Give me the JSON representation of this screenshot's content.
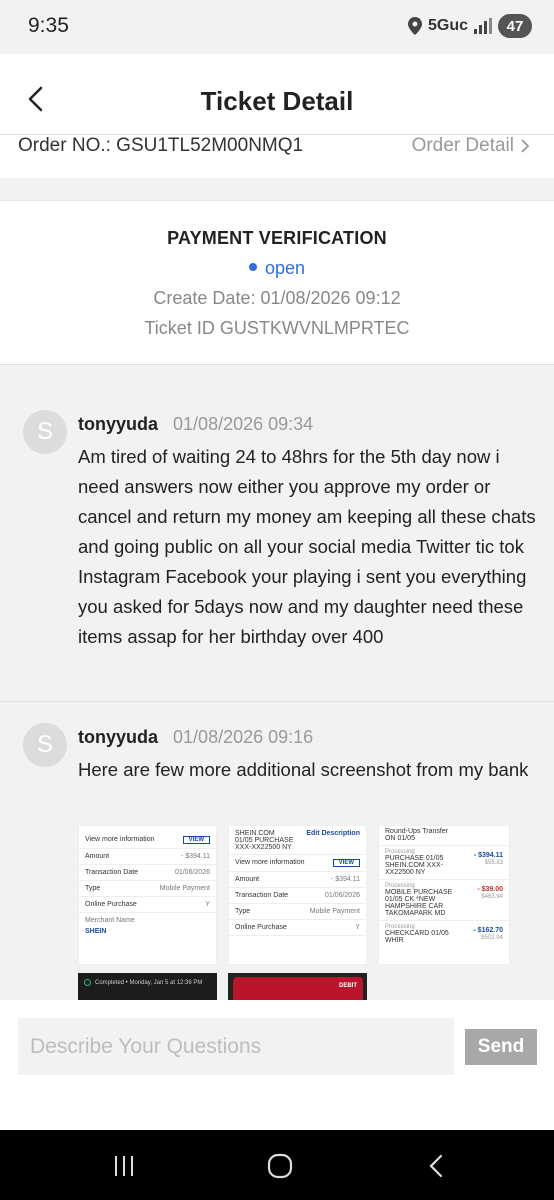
{
  "status_bar": {
    "time": "9:35",
    "network": "5Guc",
    "battery": "47"
  },
  "header": {
    "title": "Ticket Detail"
  },
  "order": {
    "order_no": "Order NO.: GSU1TL52M00NMQ1",
    "detail_link": "Order Detail"
  },
  "ticket": {
    "type": "PAYMENT VERIFICATION",
    "status": "open",
    "create_date": "Create Date: 01/08/2026 09:12",
    "ticket_id": "Ticket ID GUSTKWVNLMPRTEC"
  },
  "messages": [
    {
      "avatar": "S",
      "user": "tonyyuda",
      "time": "01/08/2026 09:34",
      "text": "Am tired of waiting 24 to 48hrs for the 5th day now i need answers now either you approve my order or cancel and return my money am keeping all these chats and going public on all your social media Twitter tic tok Instagram Facebook your playing i sent you everything you asked for 5days now and my daughter need these items assap for her birthday over 400"
    },
    {
      "avatar": "S",
      "user": "tonyyuda",
      "time": "01/08/2026 09:16",
      "text": "Here are few more additional screenshot from my bank"
    }
  ],
  "attachments": {
    "a1": {
      "view_more": "View more information",
      "view": "VIEW",
      "amount_label": "Amount",
      "amount": "- $394.11",
      "date_label": "Transaction Date",
      "date": "01/06/2026",
      "type_label": "Type",
      "type": "Mobile Payment",
      "online": "Online Purchase",
      "online_val": "Y",
      "merchant": "Merchant Name",
      "shein": "SHEIN"
    },
    "a2": {
      "line1": "SHEIN.COM",
      "line2": "01/05 PURCHASE",
      "line3": "XXX-XX22500 NY",
      "edit": "Edit Description",
      "view_more": "View more information",
      "view": "VIEW",
      "amount_label": "Amount",
      "amount": "- $394.11",
      "date_label": "Transaction Date",
      "date": "01/06/2026",
      "type_label": "Type",
      "type": "Mobile Payment",
      "online": "Online Purchase",
      "online_val": "Y"
    },
    "a3": {
      "top": "Round-Ups Transfer",
      "top2": "ON 01/05",
      "p1_label": "Processing",
      "p1_desc": "PURCHASE 01/05 SHEIN.COM XXX-XX22500 NY",
      "p1_amt": "- $394.11",
      "p1_bal": "$55.83",
      "p2_label": "Processing",
      "p2_desc": "MOBILE PURCHASE 01/05 CK *NEW HAMPSHIRE CAR TAKOMAPARK MD",
      "p2_amt": "- $39.00",
      "p2_bal": "$463.94",
      "p3_label": "Processing",
      "p3_desc": "CHECKCARD 01/05 WHIR",
      "p3_amt": "- $162.70",
      "p3_bal": "$502.94"
    },
    "a4": {
      "text": "Completed • Monday, Jan 5 at 12:36 PM"
    },
    "a5": {
      "text": "DEBIT"
    }
  },
  "composer": {
    "placeholder": "Describe Your Questions",
    "send_label": "Send"
  },
  "colors": {
    "status_open": "#2f6fde",
    "send_button": "#a8a8a8",
    "nav_bar": "#000000"
  }
}
